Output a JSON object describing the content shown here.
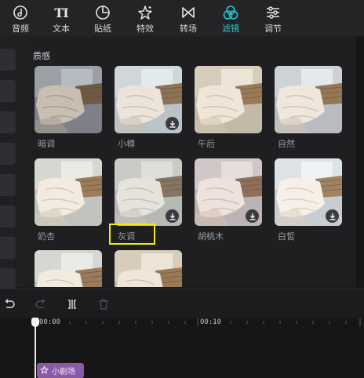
{
  "toolbar": {
    "items": [
      {
        "label": "音频",
        "icon": "music-note-icon"
      },
      {
        "label": "文本",
        "icon": "text-ti-icon",
        "glyph": "TI"
      },
      {
        "label": "贴纸",
        "icon": "sticker-icon"
      },
      {
        "label": "特效",
        "icon": "sparkle-star-icon"
      },
      {
        "label": "转场",
        "icon": "transition-bowtie-icon"
      },
      {
        "label": "滤镜",
        "icon": "filter-circles-icon"
      },
      {
        "label": "调节",
        "icon": "adjust-sliders-icon"
      }
    ],
    "active": "滤镜",
    "active_color": "#1ec8d6"
  },
  "filters": {
    "section_title": "质感",
    "items": [
      {
        "label": "暗调",
        "download": false
      },
      {
        "label": "小樽",
        "download": true
      },
      {
        "label": "午后",
        "download": false
      },
      {
        "label": "自然",
        "download": false
      },
      {
        "label": "奶杏",
        "download": false
      },
      {
        "label": "灰调",
        "download": true,
        "highlighted": true
      },
      {
        "label": "胡桃木",
        "download": true
      },
      {
        "label": "白皙",
        "download": true
      },
      {
        "label": "",
        "download": false
      },
      {
        "label": "",
        "download": false
      }
    ],
    "highlight_color": "#f1e81c"
  },
  "timeline": {
    "tools": [
      "undo-icon",
      "redo-icon",
      "split-icon",
      "delete-icon"
    ],
    "time_marks": [
      "00:00",
      "00:10"
    ],
    "clip": {
      "label": "小剧场",
      "icon": "sparkle-star-icon",
      "color": "#8a5aa6"
    }
  }
}
